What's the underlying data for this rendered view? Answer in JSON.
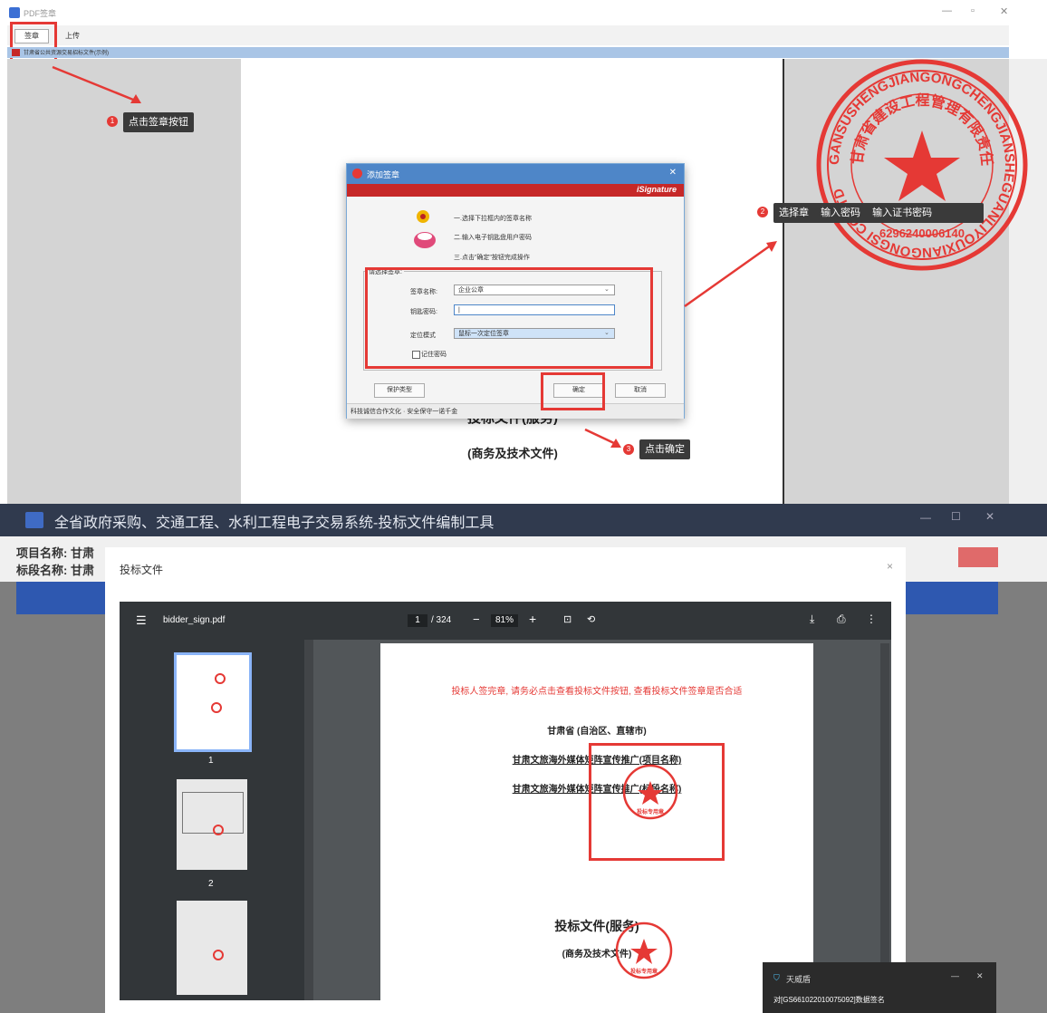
{
  "top_window": {
    "title": "PDF签章",
    "toolbar": {
      "sign_button": "签章",
      "upload_button": "上传"
    },
    "doc_tab": "甘肃省公共资源交易招标文件(示例)"
  },
  "document": {
    "title_main": "投标文件(服务)",
    "subtitle": "(商务及技术文件)"
  },
  "dialog": {
    "title": "添加签章",
    "brand": "iSignature",
    "steps": [
      "一.选择下拉框内的签章名称",
      "二.输入电子钥匙盘用户密码",
      "三.点击\"确定\"按钮完成操作"
    ],
    "group_label": "请选择签章:",
    "seal_name_label": "签章名称:",
    "seal_name_value": "企业公章",
    "password_label": "钥匙密码:",
    "position_label": "定位模式",
    "position_value": "鼠标一次定位签章",
    "remember_label": "记住密码",
    "protect_button": "保护类型",
    "ok_button": "确定",
    "cancel_button": "取消",
    "status_text": "科技诚信合作文化 · 安全保守一诺千金"
  },
  "callouts": {
    "c1_num": "1",
    "c1_text": "点击签章按钮",
    "c2_num": "2",
    "c2_text": "选择章",
    "c2_text_mid": "输入密码",
    "c2_text_b": "输入证书密码",
    "c3_num": "3",
    "c3_text": "点击确定"
  },
  "big_seal": {
    "ring_text": "GANSUSHENGJIANGONGCHENGJIANSHEGUANLIYOUXIANGONGSI CO.LTD",
    "inner_text": "甘肃省建设工程管理有限责任公司",
    "number": "6296240006140"
  },
  "bottom_app": {
    "title": "全省政府采购、交通工程、水利工程电子交易系统-投标文件编制工具",
    "project_label": "项目名称: 甘肃",
    "section_label": "标段名称: 甘肃",
    "modal_title": "投标文件",
    "modal_close": "×",
    "viewer": {
      "filename": "bidder_sign.pdf",
      "page_current": "1",
      "page_total": "/ 324",
      "zoom": "81%",
      "thumb_labels": [
        "1",
        "2"
      ]
    },
    "pdf_page": {
      "notice": "投标人签完章, 请务必点击查看投标文件按钮, 查看投标文件签章是否合适",
      "line1": "甘肃省 (自治区、直辖市)",
      "line2": "甘肃文旅海外媒体矩阵宣传推广(项目名称)",
      "line3": "甘肃文旅海外媒体矩阵宣传推广(标段名称)",
      "title": "投标文件(服务)",
      "subtitle": "(商务及技术文件)"
    },
    "seal_label": "投标专用章",
    "toast": {
      "app": "天威盾",
      "message": "对[GS661022010075092]数据签名"
    }
  }
}
